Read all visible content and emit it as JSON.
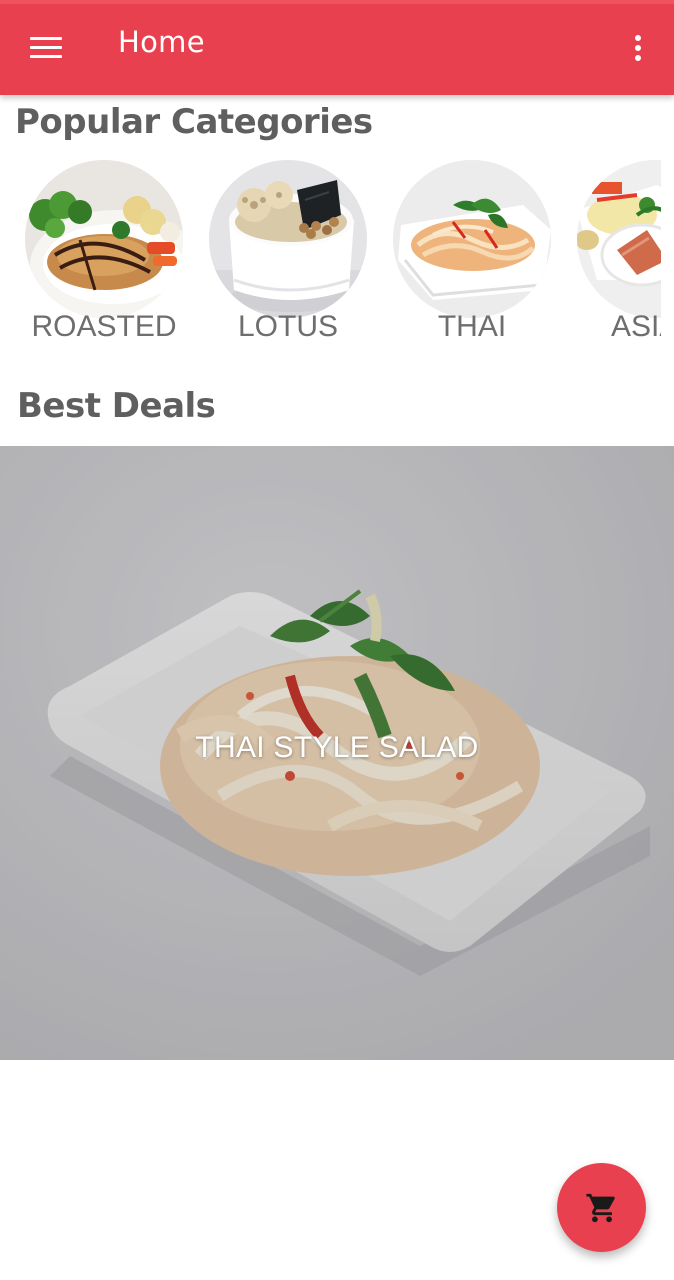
{
  "appbar": {
    "title": "Home",
    "menu_icon": "hamburger-menu-icon",
    "overflow_icon": "more-vert-icon",
    "color": "#e8404f"
  },
  "popular": {
    "title": "Popular Categories",
    "items": [
      {
        "label": "ROASTED",
        "image": "roasted-dish-image"
      },
      {
        "label": "LOTUS",
        "image": "lotus-soup-image"
      },
      {
        "label": "THAI",
        "image": "thai-noodle-image"
      },
      {
        "label": "ASIAN",
        "image": "asian-dish-image"
      }
    ]
  },
  "deals": {
    "title": "Best Deals",
    "items": [
      {
        "label": "THAI STYLE SALAD",
        "image": "thai-style-salad-image"
      }
    ]
  },
  "fab": {
    "icon": "shopping-cart-icon",
    "color": "#e8404f"
  }
}
